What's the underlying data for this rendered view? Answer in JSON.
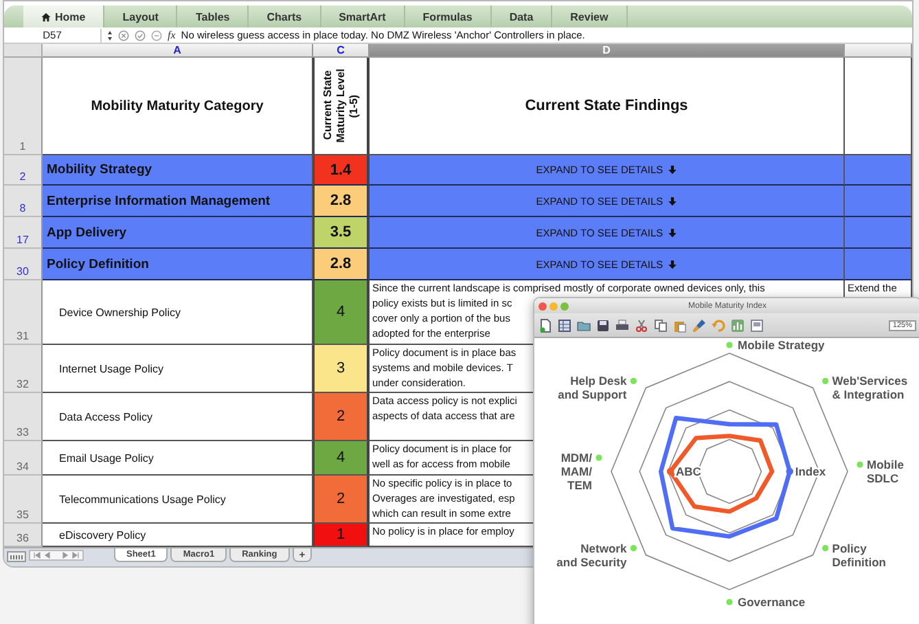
{
  "ribbon_tabs": [
    {
      "label": "Home",
      "selected": true
    },
    {
      "label": "Layout",
      "selected": false
    },
    {
      "label": "Tables",
      "selected": false
    },
    {
      "label": "Charts",
      "selected": false
    },
    {
      "label": "SmartArt",
      "selected": false
    },
    {
      "label": "Formulas",
      "selected": false
    },
    {
      "label": "Data",
      "selected": false
    },
    {
      "label": "Review",
      "selected": false
    }
  ],
  "formula_bar": {
    "cell": "D57",
    "function_label": "fx",
    "formula": "No wireless guess access in place today.  No DMZ Wireless 'Anchor' Controllers in place."
  },
  "columns": [
    {
      "label": "A",
      "selected": false
    },
    {
      "label": "C",
      "selected": false
    },
    {
      "label": "D",
      "selected": true
    }
  ],
  "header": {
    "row": "1",
    "category": "Mobility Maturity Category",
    "level_lines": [
      "Current State",
      "Maturity Level",
      "(1-5)"
    ],
    "findings": "Current State Findings"
  },
  "rows": [
    {
      "kind": "category",
      "row": "2",
      "name": "Mobility Strategy",
      "score": "1.4",
      "color": "#f2321f",
      "details": "EXPAND TO SEE DETAILS"
    },
    {
      "kind": "category",
      "row": "8",
      "name": "Enterprise Information Management",
      "score": "2.8",
      "color": "#fbcd7a",
      "details": "EXPAND TO SEE DETAILS"
    },
    {
      "kind": "category",
      "row": "17",
      "name": "App Delivery",
      "score": "3.5",
      "color": "#bfd468",
      "details": "EXPAND TO SEE DETAILS"
    },
    {
      "kind": "category",
      "row": "30",
      "name": "Policy Definition",
      "score": "2.8",
      "color": "#fbcd7a",
      "details": "EXPAND TO SEE DETAILS"
    },
    {
      "kind": "policy",
      "row": "31",
      "name": "Device Ownership Policy",
      "score": "4",
      "color": "#6da843",
      "findings": [
        "Since the current landscape is comprised mostly of corporate owned devices only, this",
        "policy exists but is limited in sc",
        "cover only a portion of the bus",
        "adopted for the enterprise"
      ],
      "column_e": "Extend the"
    },
    {
      "kind": "policy",
      "row": "32",
      "name": "Internet Usage Policy",
      "score": "3",
      "color": "#fbe58a",
      "findings": [
        "Policy document is in place bas",
        "systems and mobile devices.  T",
        "under consideration."
      ]
    },
    {
      "kind": "policy",
      "row": "33",
      "name": "Data Access Policy",
      "score": "2",
      "color": "#f26c3a",
      "findings": [
        "Data access policy is not explici",
        "aspects of data access that are"
      ]
    },
    {
      "kind": "policy",
      "row": "34",
      "name": "Email Usage Policy",
      "score": "4",
      "color": "#6da843",
      "findings": [
        "Policy document is in place for",
        "well as for access from mobile"
      ]
    },
    {
      "kind": "policy",
      "row": "35",
      "name": "Telecommunications Usage Policy",
      "score": "2",
      "color": "#f26c3a",
      "findings": [
        "No specific policy is in place to",
        "Overages are investigated, esp",
        "which can result in some extre"
      ]
    },
    {
      "kind": "policy",
      "row": "36",
      "name": "eDiscovery Policy",
      "score": "1",
      "color": "#f20f0f",
      "findings": [
        "No policy is in place for employ"
      ]
    }
  ],
  "sheet_tabs": [
    {
      "label": "Sheet1",
      "selected": true
    },
    {
      "label": "Macro1",
      "selected": false
    },
    {
      "label": "Ranking",
      "selected": false
    }
  ],
  "add_sheet": "+",
  "chart_window": {
    "title": "Mobile Maturity Index",
    "zoom": "125%",
    "axes": [
      {
        "lines": [
          "Mobile Strategy"
        ]
      },
      {
        "lines": [
          "Help Desk",
          "and Support"
        ]
      },
      {
        "lines": [
          "Web'Services",
          "& Integration"
        ]
      },
      {
        "lines": [
          "MDM/",
          "MAM/",
          "TEM"
        ]
      },
      {
        "lines": [
          "Mobile",
          "SDLC"
        ]
      },
      {
        "lines": [
          "Network",
          "and Security"
        ]
      },
      {
        "lines": [
          "Policy",
          "Definition"
        ]
      },
      {
        "lines": [
          "Governance"
        ]
      }
    ],
    "series": [
      {
        "name": "ABC",
        "color": "#f0592a"
      },
      {
        "name": "Index",
        "color": "#4f6ef5"
      }
    ]
  }
}
